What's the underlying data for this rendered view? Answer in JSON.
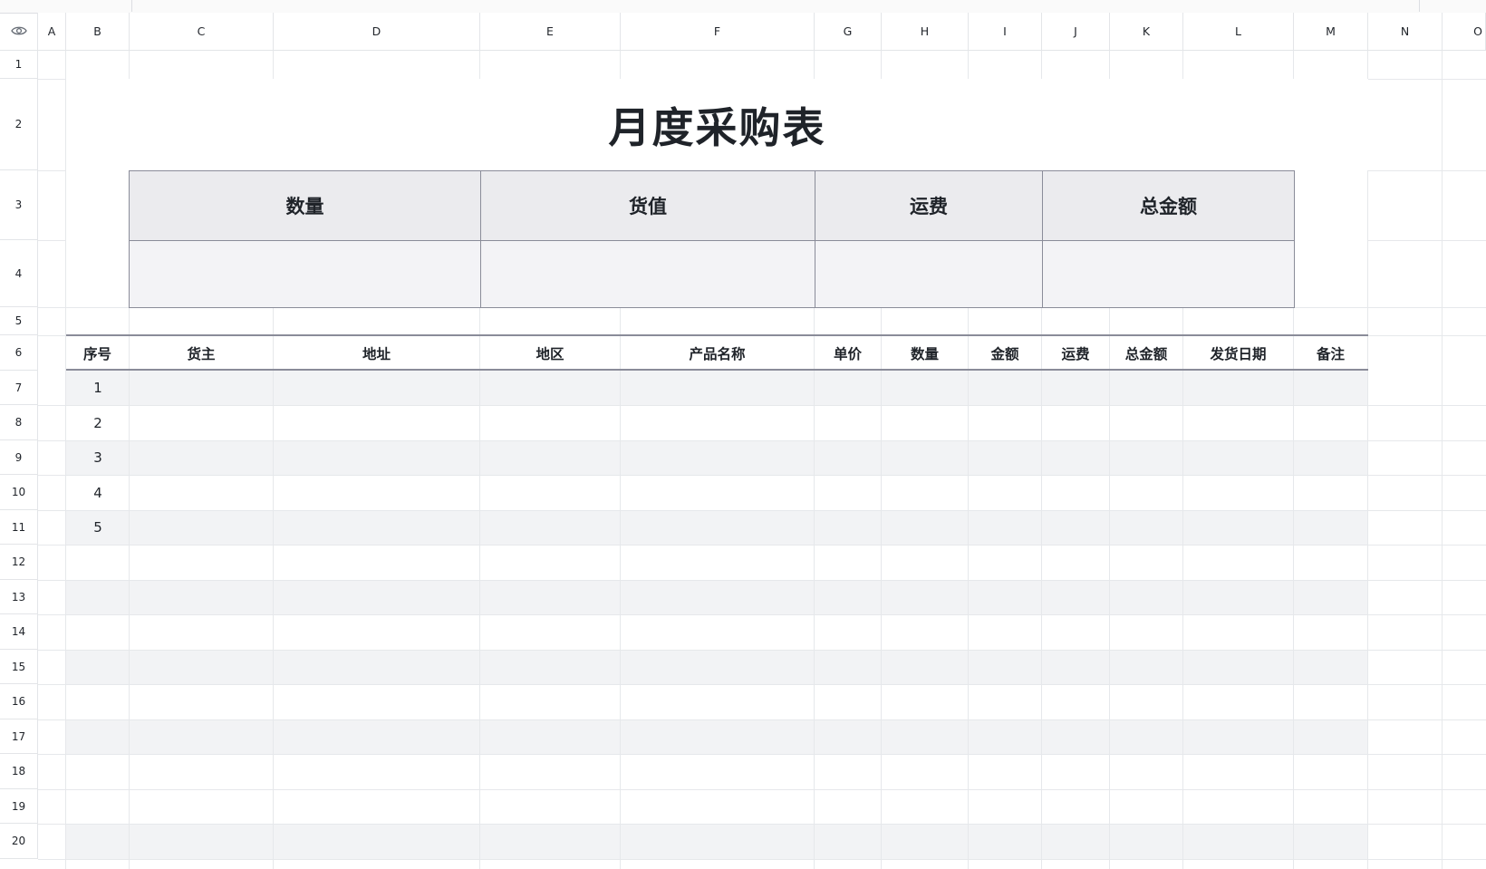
{
  "spreadsheet": {
    "columns": [
      "A",
      "B",
      "C",
      "D",
      "E",
      "F",
      "G",
      "H",
      "I",
      "J",
      "K",
      "L",
      "M",
      "N",
      "O"
    ],
    "rows": [
      "1",
      "2",
      "3",
      "4",
      "5",
      "6",
      "7",
      "8",
      "9",
      "10",
      "11",
      "12",
      "13",
      "14",
      "15",
      "16",
      "17",
      "18",
      "19",
      "20"
    ],
    "corner_icon": "eye-icon"
  },
  "title": "月度采购表",
  "summary": {
    "headers": [
      "数量",
      "货值",
      "运费",
      "总金额"
    ],
    "values": [
      "",
      "",
      "",
      ""
    ]
  },
  "table": {
    "headers": [
      "序号",
      "货主",
      "地址",
      "地区",
      "产品名称",
      "单价",
      "数量",
      "金额",
      "运费",
      "总金额",
      "发货日期",
      "备注"
    ],
    "sequence": [
      "1",
      "2",
      "3",
      "4",
      "5"
    ]
  },
  "colors": {
    "header_fill": "#ebebee",
    "value_fill": "#f3f3f6",
    "band_fill": "#f2f3f5",
    "border": "#8a8c99",
    "grid": "#e6e8eb"
  }
}
